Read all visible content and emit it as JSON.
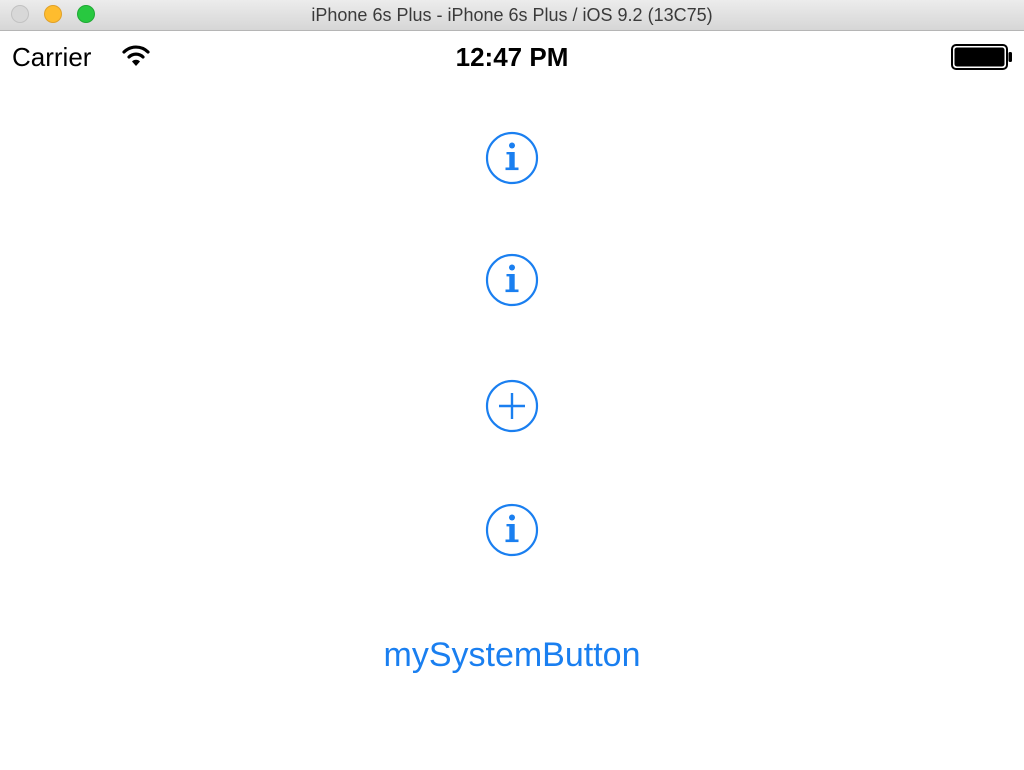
{
  "window": {
    "title": "iPhone 6s Plus - iPhone 6s Plus / iOS 9.2 (13C75)"
  },
  "status_bar": {
    "carrier": "Carrier",
    "time": "12:47 PM",
    "icons": [
      "wifi-icon",
      "battery-icon"
    ]
  },
  "buttons": [
    {
      "type": "info",
      "icon": "info-icon"
    },
    {
      "type": "info",
      "icon": "info-icon"
    },
    {
      "type": "contact-add",
      "icon": "plus-circle-icon"
    },
    {
      "type": "info",
      "icon": "info-icon"
    }
  ],
  "system_button": {
    "label": "mySystemButton"
  },
  "colors": {
    "tint": "#1a7ff0",
    "background": "#ffffff",
    "status_text": "#000000"
  }
}
